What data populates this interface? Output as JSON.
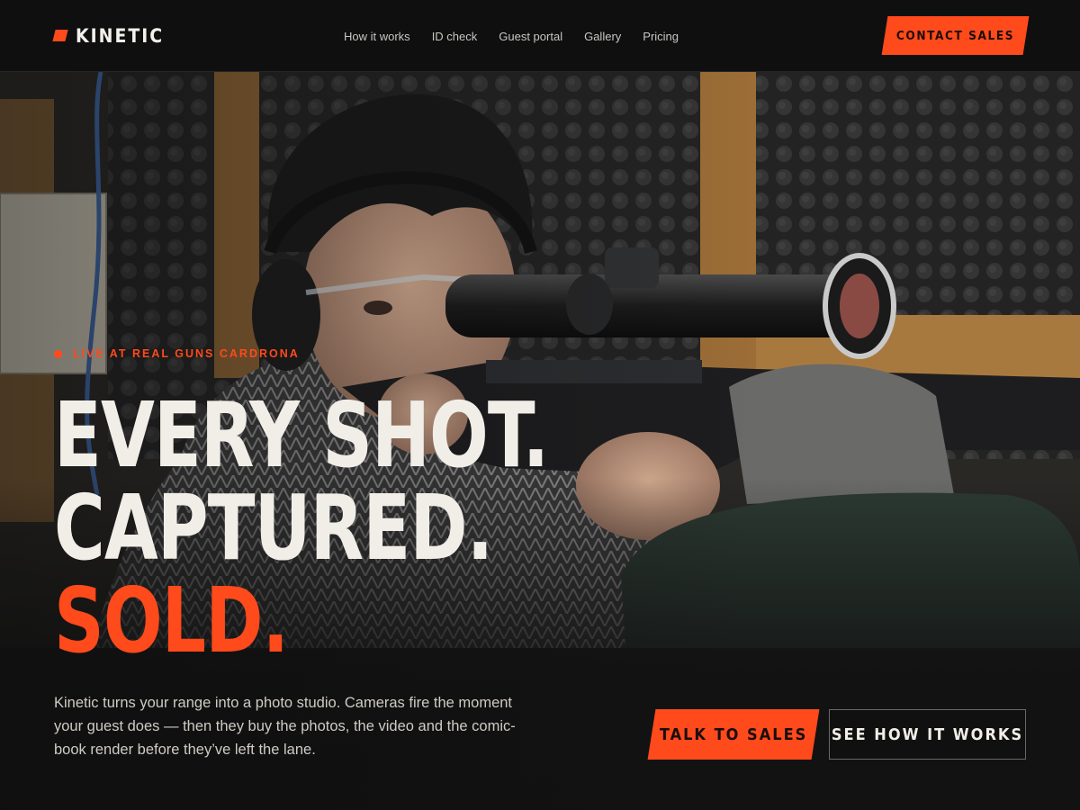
{
  "brand": {
    "name": "KINETIC",
    "accent_color": "#ff4a1c"
  },
  "nav": {
    "links": [
      "How it works",
      "ID check",
      "Guest portal",
      "Gallery",
      "Pricing"
    ],
    "cta_label": "CONTACT SALES"
  },
  "hero": {
    "eyebrow": "LIVE AT REAL GUNS CARDRONA",
    "headline": [
      "EVERY SHOT.",
      "CAPTURED.",
      "SOLD."
    ],
    "lede": "Kinetic turns your range into a photo studio. Cameras fire the moment your guest does — then they buy the photos, the video and the comic-book render before they’ve left the lane.",
    "primary_cta": "TALK TO SALES",
    "secondary_cta": "SEE HOW IT WORKS",
    "background_image": "person aiming a scoped rifle on a sandbag rest at an indoor shooting range"
  }
}
